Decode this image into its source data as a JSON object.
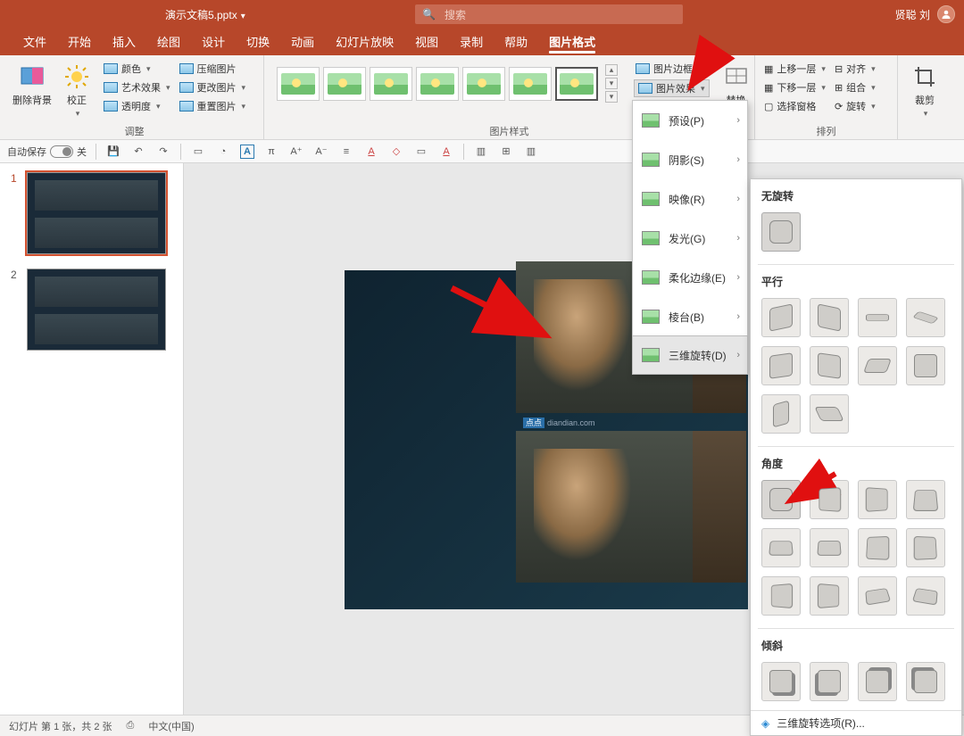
{
  "title": "演示文稿5.pptx",
  "search_placeholder": "搜索",
  "user_name": "贤聪 刘",
  "tabs": [
    "文件",
    "开始",
    "插入",
    "绘图",
    "设计",
    "切换",
    "动画",
    "幻灯片放映",
    "视图",
    "录制",
    "帮助",
    "图片格式"
  ],
  "active_tab_index": 11,
  "ribbon": {
    "remove_bg": "删除背景",
    "corrections": "校正",
    "color": "颜色",
    "artistic": "艺术效果",
    "transparency": "透明度",
    "compress": "压缩图片",
    "change": "更改图片",
    "reset": "重置图片",
    "group_adjust": "调整",
    "group_styles": "图片样式",
    "pic_border": "图片边框",
    "pic_effects": "图片效果",
    "pic_layout": "替换",
    "bring_forward": "上移一层",
    "send_backward": "下移一层",
    "selection_pane": "选择窗格",
    "align": "对齐",
    "group_obj": "组合",
    "rotate": "旋转",
    "group_arrange": "排列",
    "crop": "裁剪"
  },
  "qat": {
    "autosave": "自动保存",
    "off": "关"
  },
  "effects_menu": {
    "preset": "预设(P)",
    "shadow": "阴影(S)",
    "reflection": "映像(R)",
    "glow": "发光(G)",
    "soft_edges": "柔化边缘(E)",
    "bevel": "棱台(B)",
    "rotation3d": "三维旋转(D)"
  },
  "panel3d": {
    "none": "无旋转",
    "parallel": "平行",
    "perspective": "角度",
    "oblique": "倾斜",
    "options": "三维旋转选项(R)..."
  },
  "slide_watermark": "diandian.com",
  "status": {
    "slide_info": "幻灯片 第 1 张，共 2 张",
    "lang": "中文(中国)"
  },
  "thumbs": [
    "1",
    "2"
  ]
}
